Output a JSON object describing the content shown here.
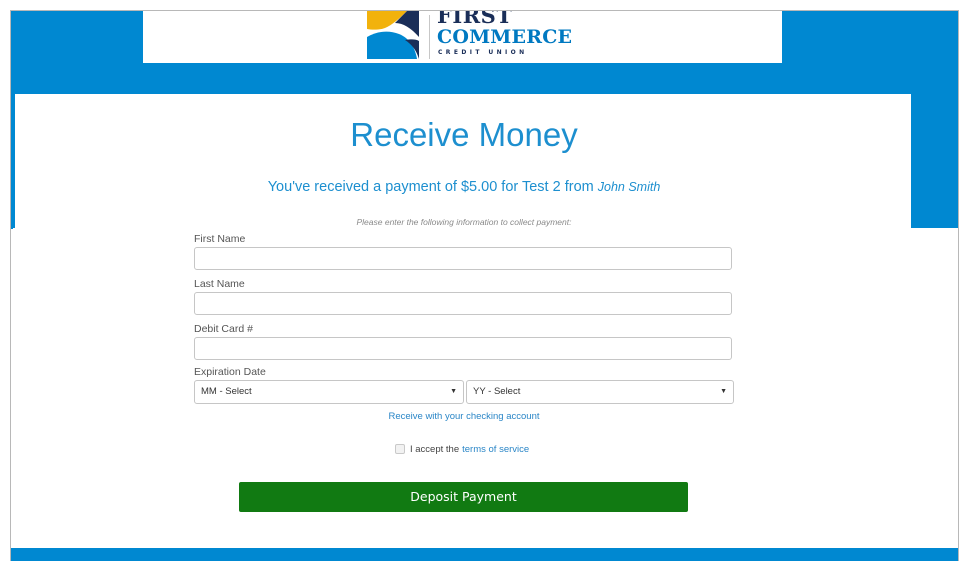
{
  "brand": {
    "name_line1": "FIRST",
    "name_line2": "COMMERCE",
    "name_line3": "CREDIT UNION",
    "colors": {
      "primary_blue": "#0088d1",
      "navy": "#1a2e58",
      "gold": "#f2b20c",
      "button_green": "#117a12"
    }
  },
  "page": {
    "title": "Receive Money",
    "payment_message": "You've received a payment of $5.00 for Test 2 from",
    "sender": "John Smith",
    "instructions": "Please enter the following information to collect payment:"
  },
  "form": {
    "first_name": {
      "label": "First Name",
      "value": "",
      "placeholder": ""
    },
    "last_name": {
      "label": "Last Name",
      "value": "",
      "placeholder": ""
    },
    "debit_card": {
      "label": "Debit Card #",
      "value": "",
      "placeholder": ""
    },
    "expiration": {
      "label": "Expiration Date",
      "month_selected": "MM - Select",
      "year_selected": "YY - Select"
    },
    "checking_link": "Receive with your checking account",
    "terms": {
      "checked": false,
      "prefix": "I accept the",
      "link": "terms of service"
    },
    "submit_label": "Deposit Payment"
  },
  "icons": {
    "caret": "caret-down-icon",
    "logo": "first-commerce-logo-icon"
  }
}
